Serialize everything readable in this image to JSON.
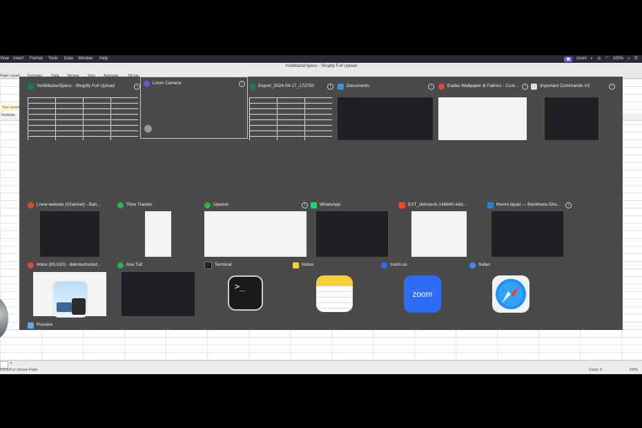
{
  "menubar": {
    "items": [
      "View",
      "Insert",
      "Format",
      "Tools",
      "Data",
      "Window",
      "Help"
    ],
    "zoom_label": "zoom",
    "battery": "100%"
  },
  "document": {
    "title": "YorkMasterSpecs - Shopify Full Upload"
  },
  "ribbon": {
    "tabs": [
      "Page Layout",
      "Formulas",
      "Data",
      "Review",
      "View",
      "Automate",
      "Tell me"
    ]
  },
  "sheet": {
    "notice": "Your recent",
    "column_header": "Features",
    "status_left": "ENTER or choose Paste",
    "count": "Count: 8",
    "zoom_level": "100%"
  },
  "mission_control": {
    "rows": [
      [
        {
          "title": "YorkMasterSpecs - Shopify Full Upload",
          "app": "excel",
          "color": "#1f7a45",
          "thumb": "sheet"
        },
        {
          "title": "Loom Camera",
          "app": "loom",
          "color": "#6e56cf",
          "thumb": "camera",
          "selected": true
        },
        {
          "title": "Export_2024-04-17_172750",
          "app": "excel",
          "color": "#1f7a45",
          "thumb": "sheet"
        },
        {
          "title": "Documents",
          "app": "finder",
          "color": "#3b8ee8",
          "thumb": "dark"
        },
        {
          "title": "Eades Wallpaper & Fabrics - Cust...",
          "app": "chrome",
          "color": "#e0453a",
          "thumb": "light"
        },
        {
          "title": "Important Commands V2",
          "app": "textedit",
          "color": "#dddddd",
          "thumb": "dark"
        }
      ],
      [
        {
          "title": "| new-website (Channel) - Ban...",
          "app": "chrome",
          "color": "#e0453a",
          "thumb": "dark"
        },
        {
          "title": "Time Tracker",
          "app": "upwork",
          "color": "#2db34a",
          "thumb": "light"
        },
        {
          "title": "Upwork",
          "app": "upwork",
          "color": "#2db34a",
          "thumb": "light"
        },
        {
          "title": "WhatsApp",
          "app": "whatsapp",
          "color": "#25d366",
          "thumb": "dark"
        },
        {
          "title": "EXT_dekstech-146840-wild...",
          "app": "figma",
          "color": "#f24e1e",
          "thumb": "light"
        },
        {
          "title": "theme.liquid — Bankhoes-Sho...",
          "app": "vscode",
          "color": "#2f80d1",
          "thumb": "dark"
        }
      ],
      [
        {
          "title": "Inbox (65,010) - dekstechsolut...",
          "app": "chrome",
          "color": "#e0453a",
          "thumb": "light"
        },
        {
          "title": "Ava Tull",
          "app": "upwork",
          "color": "#2db34a",
          "thumb": "dark"
        },
        {
          "title": "Terminal",
          "app": "terminal",
          "color": "#222222",
          "thumb": "icon"
        },
        {
          "title": "Notes",
          "app": "notes",
          "color": "#f6cf3f",
          "thumb": "icon"
        },
        {
          "title": "zoom.us",
          "app": "zoom",
          "color": "#2d6cf6",
          "thumb": "icon"
        },
        {
          "title": "Safari",
          "app": "safari",
          "color": "#3b8ee8",
          "thumb": "icon"
        }
      ],
      [
        {
          "title": "Preview",
          "app": "preview",
          "color": "#6aa6e8",
          "thumb": "icon"
        }
      ]
    ],
    "zoom_icon_text": "zoom",
    "terminal_prompt": ">_"
  }
}
